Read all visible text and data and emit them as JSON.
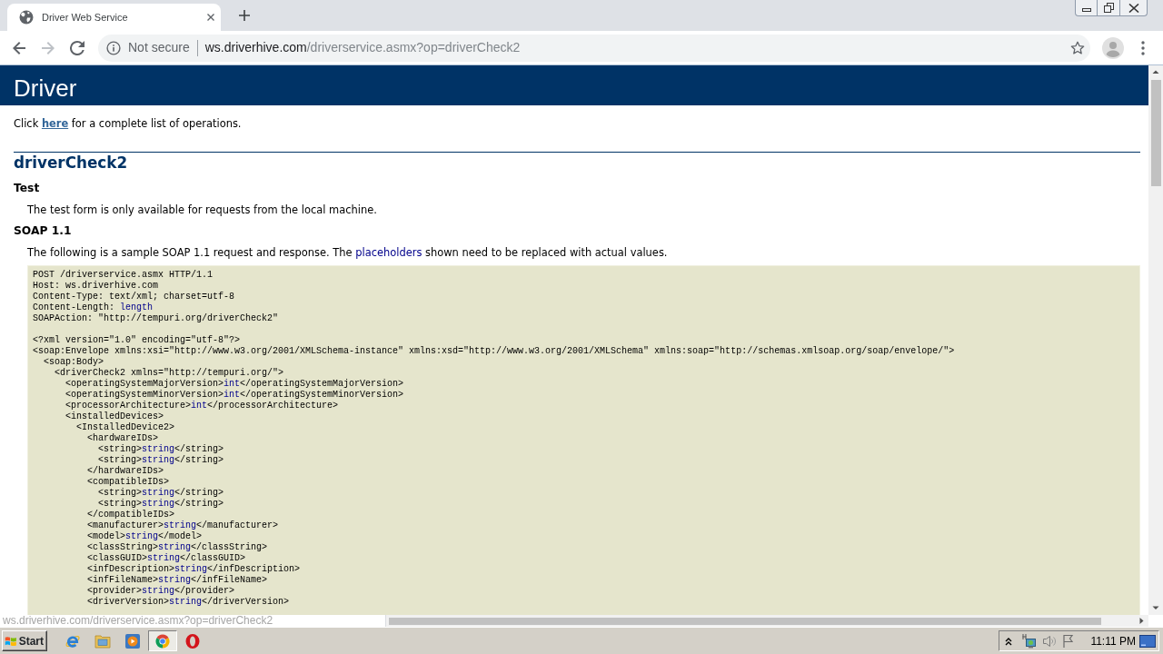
{
  "browser": {
    "tab": {
      "title": "Driver Web Service",
      "selected": true
    },
    "nav": [
      {
        "kind": "back",
        "disabled": false
      },
      {
        "kind": "forward",
        "disabled": true
      },
      {
        "kind": "reload",
        "disabled": false
      }
    ],
    "address": {
      "security": "Not secure",
      "host": "ws.driverhive.com",
      "path": "/driverservice.asmx?op=driverCheck2"
    }
  },
  "page": {
    "banner": "Driver",
    "intro": [
      {
        "text": "Click ",
        "kind": "plain"
      },
      {
        "text": "here",
        "kind": "link"
      },
      {
        "text": " for a complete list of operations.",
        "kind": "plain"
      }
    ],
    "operation": "driverCheck2",
    "sections": [
      {
        "heading": "Test",
        "text": [
          {
            "text": "The test form is only available for requests from the local machine.",
            "kind": "plain"
          }
        ]
      },
      {
        "heading": "SOAP 1.1",
        "text": [
          {
            "text": "The following is a sample SOAP 1.1 request and response. The ",
            "kind": "plain"
          },
          {
            "text": "placeholders",
            "kind": "value"
          },
          {
            "text": " shown need to be replaced with actual values.",
            "kind": "plain"
          }
        ],
        "sample": {
          "headers": [
            [
              {
                "text": "POST /driverservice.asmx HTTP/1.1",
                "kind": "plain"
              }
            ],
            [
              {
                "text": "Host: ws.driverhive.com",
                "kind": "plain"
              }
            ],
            [
              {
                "text": "Content-Type: text/xml; charset=utf-8",
                "kind": "plain"
              }
            ],
            [
              {
                "text": "Content-Length: ",
                "kind": "plain"
              },
              {
                "text": "length",
                "kind": "value"
              }
            ],
            [
              {
                "text": "SOAPAction: \"http://tempuri.org/driverCheck2\"",
                "kind": "plain"
              }
            ]
          ],
          "body": [
            {
              "parts": [
                {
                  "text": "<?xml version=\"1.0\" encoding=\"utf-8\"?>",
                  "kind": "plain"
                }
              ]
            },
            {
              "parts": [
                {
                  "text": "<soap:Envelope xmlns:xsi=\"http://www.w3.org/2001/XMLSchema-instance\" xmlns:xsd=\"http://www.w3.org/2001/XMLSchema\" xmlns:soap=\"http://schemas.xmlsoap.org/soap/envelope/\">",
                  "kind": "plain"
                }
              ],
              "children": [
                {
                  "parts": [
                    {
                      "text": "<soap:Body>",
                      "kind": "plain"
                    }
                  ],
                  "children": [
                    {
                      "parts": [
                        {
                          "text": "<driverCheck2 xmlns=\"http://tempuri.org/\">",
                          "kind": "plain"
                        }
                      ],
                      "children": [
                        {
                          "parts": [
                            {
                              "text": "<operatingSystemMajorVersion>",
                              "kind": "plain"
                            },
                            {
                              "text": "int",
                              "kind": "value"
                            },
                            {
                              "text": "</operatingSystemMajorVersion>",
                              "kind": "plain"
                            }
                          ]
                        },
                        {
                          "parts": [
                            {
                              "text": "<operatingSystemMinorVersion>",
                              "kind": "plain"
                            },
                            {
                              "text": "int",
                              "kind": "value"
                            },
                            {
                              "text": "</operatingSystemMinorVersion>",
                              "kind": "plain"
                            }
                          ]
                        },
                        {
                          "parts": [
                            {
                              "text": "<processorArchitecture>",
                              "kind": "plain"
                            },
                            {
                              "text": "int",
                              "kind": "value"
                            },
                            {
                              "text": "</processorArchitecture>",
                              "kind": "plain"
                            }
                          ]
                        },
                        {
                          "parts": [
                            {
                              "text": "<installedDevices>",
                              "kind": "plain"
                            }
                          ],
                          "children": [
                            {
                              "parts": [
                                {
                                  "text": "<InstalledDevice2>",
                                  "kind": "plain"
                                }
                              ],
                              "children": [
                                {
                                  "parts": [
                                    {
                                      "text": "<hardwareIDs>",
                                      "kind": "plain"
                                    }
                                  ],
                                  "children": [
                                    {
                                      "parts": [
                                        {
                                          "text": "<string>",
                                          "kind": "plain"
                                        },
                                        {
                                          "text": "string",
                                          "kind": "value"
                                        },
                                        {
                                          "text": "</string>",
                                          "kind": "plain"
                                        }
                                      ]
                                    },
                                    {
                                      "parts": [
                                        {
                                          "text": "<string>",
                                          "kind": "plain"
                                        },
                                        {
                                          "text": "string",
                                          "kind": "value"
                                        },
                                        {
                                          "text": "</string>",
                                          "kind": "plain"
                                        }
                                      ]
                                    }
                                  ],
                                  "end": [
                                    {
                                      "text": "</hardwareIDs>",
                                      "kind": "plain"
                                    }
                                  ]
                                },
                                {
                                  "parts": [
                                    {
                                      "text": "<compatibleIDs>",
                                      "kind": "plain"
                                    }
                                  ],
                                  "children": [
                                    {
                                      "parts": [
                                        {
                                          "text": "<string>",
                                          "kind": "plain"
                                        },
                                        {
                                          "text": "string",
                                          "kind": "value"
                                        },
                                        {
                                          "text": "</string>",
                                          "kind": "plain"
                                        }
                                      ]
                                    },
                                    {
                                      "parts": [
                                        {
                                          "text": "<string>",
                                          "kind": "plain"
                                        },
                                        {
                                          "text": "string",
                                          "kind": "value"
                                        },
                                        {
                                          "text": "</string>",
                                          "kind": "plain"
                                        }
                                      ]
                                    }
                                  ],
                                  "end": [
                                    {
                                      "text": "</compatibleIDs>",
                                      "kind": "plain"
                                    }
                                  ]
                                },
                                {
                                  "parts": [
                                    {
                                      "text": "<manufacturer>",
                                      "kind": "plain"
                                    },
                                    {
                                      "text": "string",
                                      "kind": "value"
                                    },
                                    {
                                      "text": "</manufacturer>",
                                      "kind": "plain"
                                    }
                                  ]
                                },
                                {
                                  "parts": [
                                    {
                                      "text": "<model>",
                                      "kind": "plain"
                                    },
                                    {
                                      "text": "string",
                                      "kind": "value"
                                    },
                                    {
                                      "text": "</model>",
                                      "kind": "plain"
                                    }
                                  ]
                                },
                                {
                                  "parts": [
                                    {
                                      "text": "<classString>",
                                      "kind": "plain"
                                    },
                                    {
                                      "text": "string",
                                      "kind": "value"
                                    },
                                    {
                                      "text": "</classString>",
                                      "kind": "plain"
                                    }
                                  ]
                                },
                                {
                                  "parts": [
                                    {
                                      "text": "<classGUID>",
                                      "kind": "plain"
                                    },
                                    {
                                      "text": "string",
                                      "kind": "value"
                                    },
                                    {
                                      "text": "</classGUID>",
                                      "kind": "plain"
                                    }
                                  ]
                                },
                                {
                                  "parts": [
                                    {
                                      "text": "<infDescription>",
                                      "kind": "plain"
                                    },
                                    {
                                      "text": "string",
                                      "kind": "value"
                                    },
                                    {
                                      "text": "</infDescription>",
                                      "kind": "plain"
                                    }
                                  ]
                                },
                                {
                                  "parts": [
                                    {
                                      "text": "<infFileName>",
                                      "kind": "plain"
                                    },
                                    {
                                      "text": "string",
                                      "kind": "value"
                                    },
                                    {
                                      "text": "</infFileName>",
                                      "kind": "plain"
                                    }
                                  ]
                                },
                                {
                                  "parts": [
                                    {
                                      "text": "<provider>",
                                      "kind": "plain"
                                    },
                                    {
                                      "text": "string",
                                      "kind": "value"
                                    },
                                    {
                                      "text": "</provider>",
                                      "kind": "plain"
                                    }
                                  ]
                                },
                                {
                                  "parts": [
                                    {
                                      "text": "<driverVersion>",
                                      "kind": "plain"
                                    },
                                    {
                                      "text": "string",
                                      "kind": "value"
                                    },
                                    {
                                      "text": "</driverVersion>",
                                      "kind": "plain"
                                    }
                                  ]
                                }
                              ]
                            }
                          ]
                        }
                      ]
                    }
                  ]
                }
              ]
            }
          ]
        }
      }
    ]
  },
  "status_bubble": {
    "url": "ws.driverhive.com/driverservice.asmx?op=driverCheck2"
  },
  "taskbar": {
    "start": "Start",
    "apps": [
      {
        "kind": "e_globe",
        "selected": false
      },
      {
        "kind": "folder",
        "selected": false
      },
      {
        "kind": "play",
        "selected": false
      },
      {
        "kind": "wheel",
        "selected": true
      },
      {
        "kind": "ring",
        "selected": false
      }
    ],
    "clock": "11:11 PM"
  }
}
